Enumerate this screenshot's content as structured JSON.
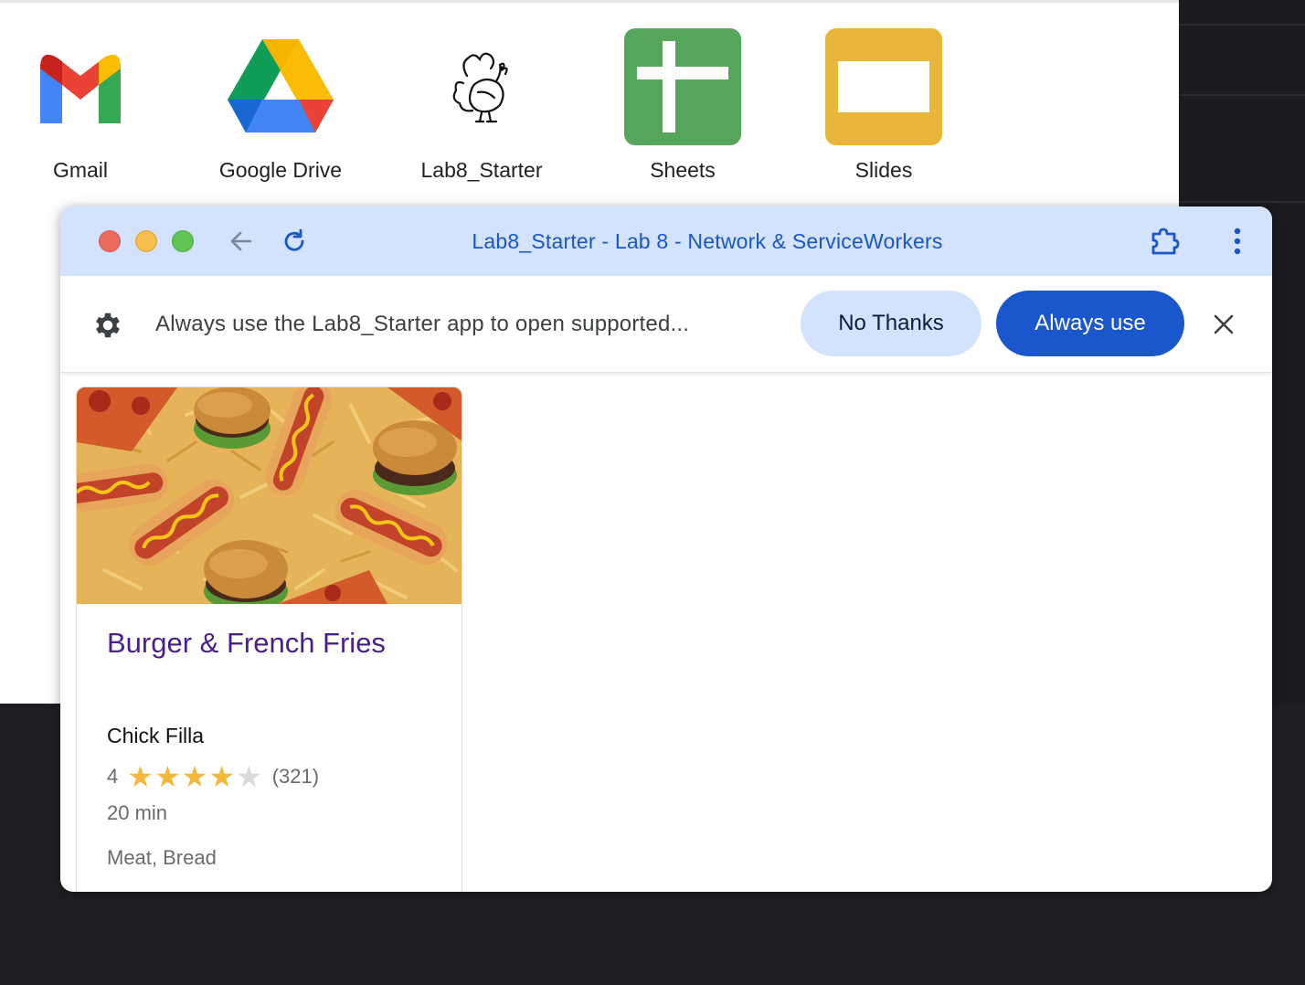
{
  "launcher": {
    "apps": [
      {
        "label": "Gmail",
        "icon": "gmail-icon"
      },
      {
        "label": "Google Drive",
        "icon": "google-drive-icon"
      },
      {
        "label": "Lab8_Starter",
        "icon": "turkey-icon"
      },
      {
        "label": "Sheets",
        "icon": "sheets-icon"
      },
      {
        "label": "Slides",
        "icon": "slides-icon"
      }
    ]
  },
  "window": {
    "title": "Lab8_Starter - Lab 8 - Network & ServiceWorkers",
    "accent": "#d3e3fd",
    "title_color": "#1a56c4"
  },
  "infobar": {
    "message": "Always use the Lab8_Starter app to open supported...",
    "no_thanks_label": "No Thanks",
    "always_use_label": "Always use",
    "primary_color": "#1a56cc"
  },
  "recipe_card": {
    "title": "Burger & French Fries",
    "organization": "Chick Filla",
    "rating_value": "4",
    "stars_filled": 4,
    "stars_total": 5,
    "rating_count": "(321)",
    "time": "20 min",
    "ingredients": "Meat, Bread",
    "star_color": "#f4b93a",
    "image": "burgers-hotdogs-fries-photo"
  }
}
